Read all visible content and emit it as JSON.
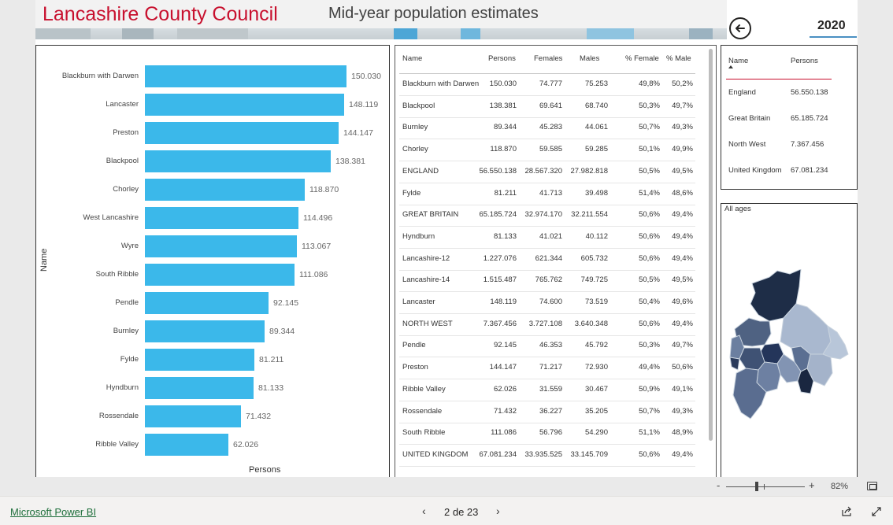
{
  "header": {
    "title": "Lancashire County Council",
    "subtitle": "Mid-year population estimates",
    "year": "2020"
  },
  "bar_chart": {
    "x_axis_title": "Persons",
    "y_axis_title": "Name"
  },
  "chart_data": {
    "type": "bar",
    "orientation": "horizontal",
    "categories": [
      "Blackburn with Darwen",
      "Lancaster",
      "Preston",
      "Blackpool",
      "Chorley",
      "West Lancashire",
      "Wyre",
      "South Ribble",
      "Pendle",
      "Burnley",
      "Fylde",
      "Hyndburn",
      "Rossendale",
      "Ribble Valley"
    ],
    "values": [
      150030,
      148119,
      144147,
      138381,
      118870,
      114496,
      113067,
      111086,
      92145,
      89344,
      81211,
      81133,
      71432,
      62026
    ],
    "value_labels": [
      "150.030",
      "148.119",
      "144.147",
      "138.381",
      "118.870",
      "114.496",
      "113.067",
      "111.086",
      "92.145",
      "89.344",
      "81.211",
      "81.133",
      "71.432",
      "62.026"
    ],
    "xlabel": "Persons",
    "ylabel": "Name",
    "xlim": [
      0,
      152000
    ],
    "color": "#3bb8ea",
    "legend": "none",
    "grid": false
  },
  "table": {
    "columns": [
      "Name",
      "Persons",
      "Females",
      "Males",
      "% Female",
      "% Male"
    ],
    "rows": [
      [
        "Blackburn with Darwen",
        "150.030",
        "74.777",
        "75.253",
        "49,8%",
        "50,2%"
      ],
      [
        "Blackpool",
        "138.381",
        "69.641",
        "68.740",
        "50,3%",
        "49,7%"
      ],
      [
        "Burnley",
        "89.344",
        "45.283",
        "44.061",
        "50,7%",
        "49,3%"
      ],
      [
        "Chorley",
        "118.870",
        "59.585",
        "59.285",
        "50,1%",
        "49,9%"
      ],
      [
        "ENGLAND",
        "56.550.138",
        "28.567.320",
        "27.982.818",
        "50,5%",
        "49,5%"
      ],
      [
        "Fylde",
        "81.211",
        "41.713",
        "39.498",
        "51,4%",
        "48,6%"
      ],
      [
        "GREAT BRITAIN",
        "65.185.724",
        "32.974.170",
        "32.211.554",
        "50,6%",
        "49,4%"
      ],
      [
        "Hyndburn",
        "81.133",
        "41.021",
        "40.112",
        "50,6%",
        "49,4%"
      ],
      [
        "Lancashire-12",
        "1.227.076",
        "621.344",
        "605.732",
        "50,6%",
        "49,4%"
      ],
      [
        "Lancashire-14",
        "1.515.487",
        "765.762",
        "749.725",
        "50,5%",
        "49,5%"
      ],
      [
        "Lancaster",
        "148.119",
        "74.600",
        "73.519",
        "50,4%",
        "49,6%"
      ],
      [
        "NORTH WEST",
        "7.367.456",
        "3.727.108",
        "3.640.348",
        "50,6%",
        "49,4%"
      ],
      [
        "Pendle",
        "92.145",
        "46.353",
        "45.792",
        "50,3%",
        "49,7%"
      ],
      [
        "Preston",
        "144.147",
        "71.217",
        "72.930",
        "49,4%",
        "50,6%"
      ],
      [
        "Ribble Valley",
        "62.026",
        "31.559",
        "30.467",
        "50,9%",
        "49,1%"
      ],
      [
        "Rossendale",
        "71.432",
        "36.227",
        "35.205",
        "50,7%",
        "49,3%"
      ],
      [
        "South Ribble",
        "111.086",
        "56.796",
        "54.290",
        "51,1%",
        "48,9%"
      ],
      [
        "UNITED KINGDOM",
        "67.081.234",
        "33.935.525",
        "33.145.709",
        "50,6%",
        "49,4%"
      ]
    ]
  },
  "comparison": {
    "columns": [
      "Name",
      "Persons"
    ],
    "rows": [
      [
        "England",
        "56.550.138"
      ],
      [
        "Great Britain",
        "65.185.724"
      ],
      [
        "North West",
        "7.367.456"
      ],
      [
        "United Kingdom",
        "67.081.234"
      ]
    ]
  },
  "map": {
    "title": "All ages"
  },
  "zoom": {
    "value": "82%",
    "minus": "-",
    "plus": "+"
  },
  "footer": {
    "brand_link": "Microsoft Power BI",
    "page_indicator": "2 de 23",
    "prev": "‹",
    "next": "›"
  },
  "icons": {
    "back": "back-arrow-icon",
    "fit": "fit-to-page-icon",
    "share": "share-icon",
    "expand": "expand-icon"
  }
}
